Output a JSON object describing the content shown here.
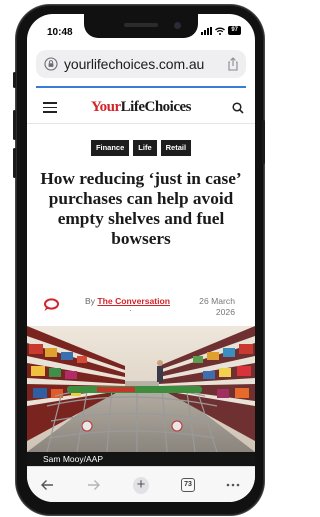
{
  "status_bar": {
    "time": "10:48",
    "battery": "97"
  },
  "browser": {
    "url": "yourlifechoices.com.au",
    "tab_count": "73"
  },
  "site": {
    "logo_your": "Your",
    "logo_rest": "LifeChoices"
  },
  "article": {
    "tags": [
      "Finance",
      "Life",
      "Retail"
    ],
    "headline": "How reducing ‘just in case’ purchases can help avoid empty shelves and fuel bowsers",
    "byline_prefix": "By",
    "author": "The Conversation",
    "date": "26 March 2026",
    "image_caption": "Sam Mooy/AAP"
  },
  "colors": {
    "brand_red": "#d2252b",
    "progress_blue": "#3a7bd5",
    "tag_bg": "#1d1d1d"
  },
  "icons": {
    "lock": "lock-icon",
    "share": "share-icon",
    "menu": "hamburger-menu-icon",
    "search": "search-icon",
    "comment": "comment-bubble-icon",
    "back": "back-arrow-icon",
    "forward": "forward-arrow-icon",
    "new_tab": "plus-icon",
    "tabs": "tabs-icon",
    "more": "more-icon"
  }
}
